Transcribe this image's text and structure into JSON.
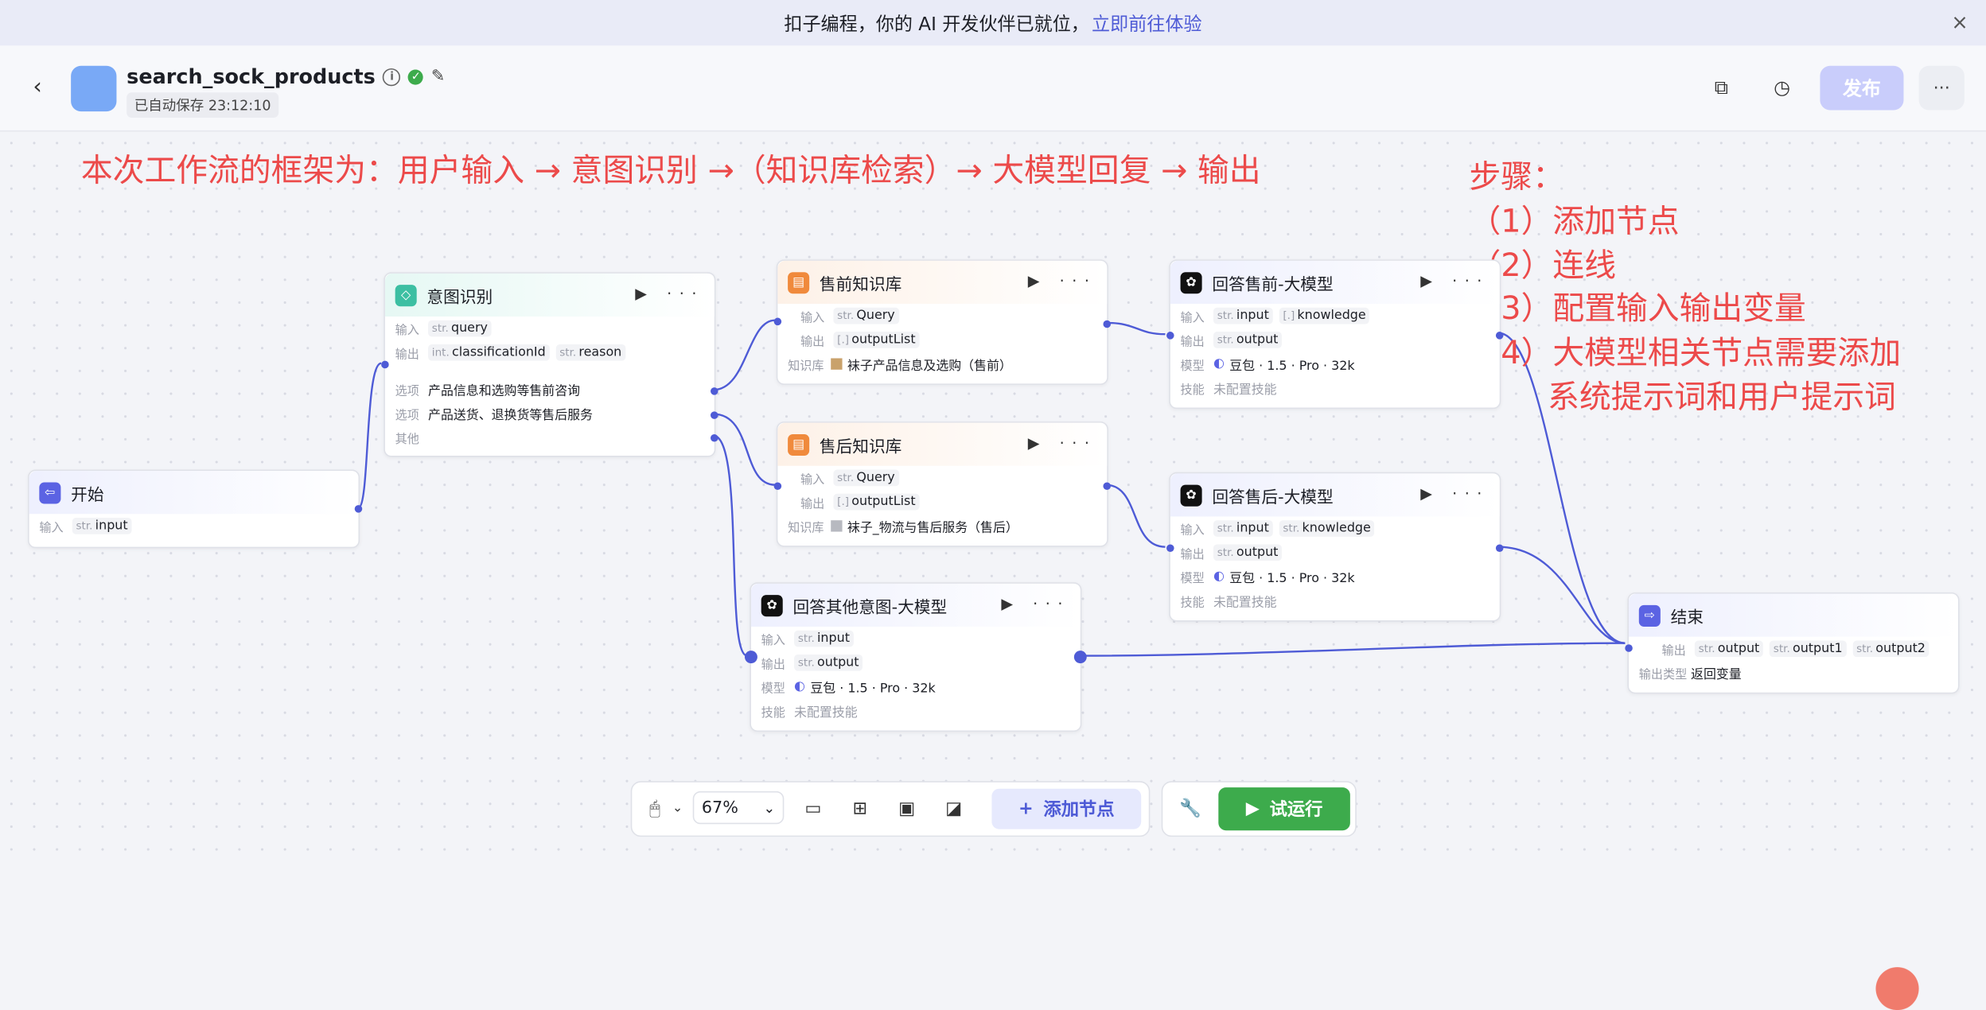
{
  "banner": {
    "text": "扣子编程，你的 AI 开发伙伴已就位，",
    "link": "立即前往体验",
    "close_icon": "×"
  },
  "header": {
    "title": "search_sock_products",
    "saved": "已自动保存 23:12:10",
    "publish": "发布",
    "more": "···"
  },
  "annotations": {
    "framework": "本次工作流的框架为：用户输入 → 意图识别 →（知识库检索）→ 大模型回复 → 输出",
    "steps_title": "步骤：",
    "step1": "（1）添加节点",
    "step2": "（2）连线",
    "step3": "（3）配置输入输出变量",
    "step4a": "（4）大模型相关节点需要添加",
    "step4b": "系统提示词和用户提示词"
  },
  "labels": {
    "input": "输入",
    "output": "输出",
    "option": "选项",
    "other": "其他",
    "kb": "知识库",
    "model": "模型",
    "skill": "技能",
    "out_type": "输出类型"
  },
  "types": {
    "str": "str.",
    "int": "int.",
    "list": "[.]"
  },
  "nodes": {
    "start": {
      "title": "开始",
      "input": "input"
    },
    "intent": {
      "title": "意图识别",
      "input": "query",
      "out1": "classificationId",
      "out2": "reason",
      "opt1": "产品信息和选购等售前咨询",
      "opt2": "产品送货、退换货等售后服务"
    },
    "pre_kb": {
      "title": "售前知识库",
      "input": "Query",
      "output": "outputList",
      "kb": "袜子产品信息及选购（售前）"
    },
    "post_kb": {
      "title": "售后知识库",
      "input": "Query",
      "output": "outputList",
      "kb": "袜子_物流与售后服务（售后）"
    },
    "other_llm": {
      "title": "回答其他意图-大模型",
      "input": "input",
      "output": "output",
      "model": "豆包 · 1.5 · Pro · 32k",
      "skill": "未配置技能"
    },
    "pre_llm": {
      "title": "回答售前-大模型",
      "input1": "input",
      "input2": "knowledge",
      "output": "output",
      "model": "豆包 · 1.5 · Pro · 32k",
      "skill": "未配置技能"
    },
    "post_llm": {
      "title": "回答售后-大模型",
      "input1": "input",
      "input2": "knowledge",
      "output": "output",
      "model": "豆包 · 1.5 · Pro · 32k",
      "skill": "未配置技能"
    },
    "end": {
      "title": "结束",
      "out1": "output",
      "out2": "output1",
      "out3": "output2",
      "out_type": "返回变量"
    }
  },
  "toolbar": {
    "zoom": "67%",
    "add_node": "添加节点",
    "run": "试运行"
  },
  "colors": {
    "accent": "#4e5bd6",
    "annotation": "#ec4a4a",
    "run": "#3dab4c"
  }
}
